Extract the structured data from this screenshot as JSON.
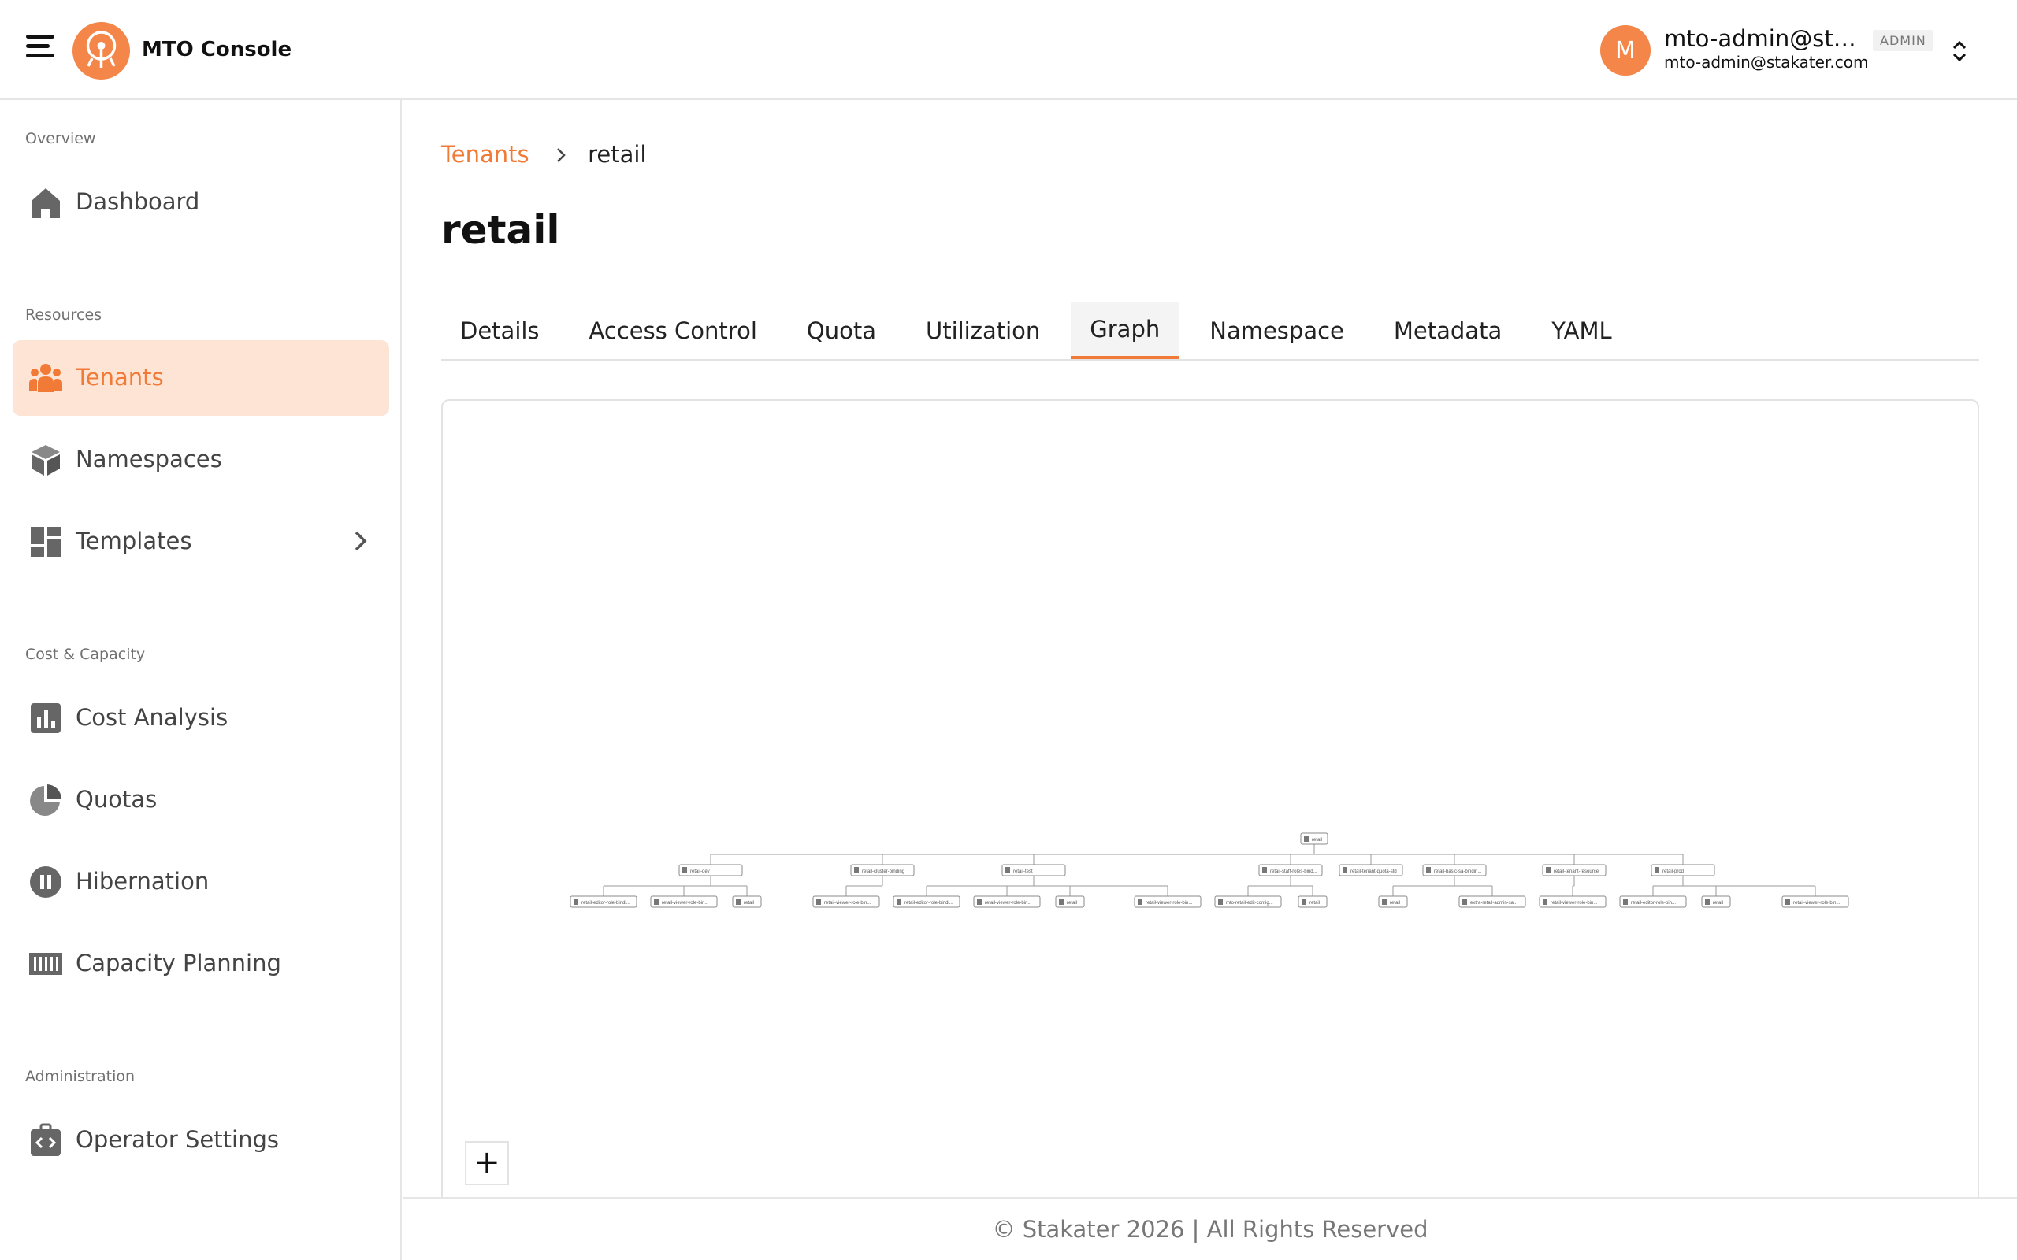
{
  "header": {
    "brand": "MTO Console",
    "user": {
      "avatar_initial": "M",
      "name": "mto-admin@sta...",
      "email": "mto-admin@stakater.com",
      "role": "ADMIN"
    }
  },
  "sidebar": {
    "sections": [
      {
        "label": "Overview",
        "items": [
          {
            "label": "Dashboard",
            "icon": "home-icon"
          }
        ]
      },
      {
        "label": "Resources",
        "items": [
          {
            "label": "Tenants",
            "icon": "users-icon",
            "active": true
          },
          {
            "label": "Namespaces",
            "icon": "cube-icon"
          },
          {
            "label": "Templates",
            "icon": "grid-icon",
            "has_children": true
          }
        ]
      },
      {
        "label": "Cost & Capacity",
        "items": [
          {
            "label": "Cost Analysis",
            "icon": "bar-chart-icon"
          },
          {
            "label": "Quotas",
            "icon": "pie-chart-icon"
          },
          {
            "label": "Hibernation",
            "icon": "pause-icon"
          },
          {
            "label": "Capacity Planning",
            "icon": "barcode-icon"
          }
        ]
      },
      {
        "label": "Administration",
        "items": [
          {
            "label": "Operator Settings",
            "icon": "code-briefcase-icon"
          }
        ]
      }
    ]
  },
  "breadcrumb": {
    "parent": "Tenants",
    "current": "retail"
  },
  "page": {
    "title": "retail"
  },
  "tabs": [
    {
      "label": "Details"
    },
    {
      "label": "Access Control"
    },
    {
      "label": "Quota"
    },
    {
      "label": "Utilization"
    },
    {
      "label": "Graph",
      "active": true
    },
    {
      "label": "Namespace"
    },
    {
      "label": "Metadata"
    },
    {
      "label": "YAML"
    }
  ],
  "graph": {
    "zoom_in_label": "+",
    "root": {
      "label": "retail"
    },
    "level1": [
      {
        "label": "retail-dev"
      },
      {
        "label": "retail-cluster-binding"
      },
      {
        "label": "retail-test"
      },
      {
        "label": "retail-staff-roles-bind..."
      },
      {
        "label": "retail-tenant-quota-std"
      },
      {
        "label": "retail-basic-sa-bindin..."
      },
      {
        "label": "retail-tenant-resource"
      },
      {
        "label": "retail-prod"
      }
    ],
    "level2": [
      {
        "label": "retail-editor-role-bindi..."
      },
      {
        "label": "retail-viewer-role-bin..."
      },
      {
        "label": "retail"
      },
      {
        "label": "retail-viewer-role-bin..."
      },
      {
        "label": "retail-editor-role-bindi..."
      },
      {
        "label": "retail-viewer-role-bin..."
      },
      {
        "label": "retail"
      },
      {
        "label": "retail-viewer-role-bin..."
      },
      {
        "label": "mto-retail-edit-config..."
      },
      {
        "label": "retail"
      },
      {
        "label": "retail"
      },
      {
        "label": "extra-retail-admin-sa..."
      },
      {
        "label": "retail-viewer-role-bin..."
      },
      {
        "label": "retail-editor-role-bin..."
      },
      {
        "label": "retail"
      },
      {
        "label": "retail-viewer-role-bin..."
      }
    ]
  },
  "footer": {
    "text": "© Stakater 2026 | All Rights Reserved"
  },
  "colors": {
    "accent": "#f07a36",
    "accent_light": "#fde4d5",
    "icon_gray": "#666666"
  }
}
